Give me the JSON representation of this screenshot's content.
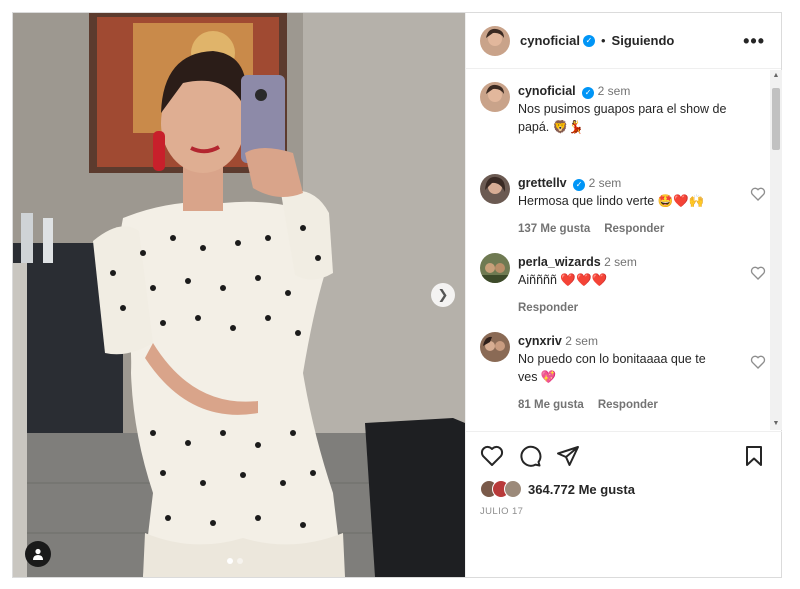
{
  "post": {
    "username": "cynoficial",
    "verified_mark": "✓",
    "separator": "•",
    "follow_status": "Siguiendo",
    "more_options": "•••",
    "caption": {
      "username": "cynoficial",
      "time": "2 sem",
      "text": "Nos pusimos guapos para el show de papá. 🦁💃"
    },
    "media": {
      "slides": 2,
      "active_slide": 1,
      "next_icon": "chevron-right-icon",
      "tag_icon": "user-tag-icon"
    }
  },
  "comments": [
    {
      "username": "grettellv",
      "verified": true,
      "time": "2 sem",
      "text": "Hermosa que lindo verte 🤩❤️🙌",
      "likes": "137 Me gusta",
      "reply": "Responder"
    },
    {
      "username": "perla_wizards",
      "verified": false,
      "time": "2 sem",
      "text": "Aiññññ ❤️❤️❤️",
      "likes": "",
      "reply": "Responder"
    },
    {
      "username": "cynxriv",
      "verified": false,
      "time": "2 sem",
      "text": "No puedo con lo bonitaaaa que te ves 💖",
      "likes": "81 Me gusta",
      "reply": "Responder"
    }
  ],
  "actions": {
    "like_icon": "heart-icon",
    "comment_icon": "comment-icon",
    "share_icon": "send-icon",
    "save_icon": "bookmark-icon",
    "like_count": "364.772 Me gusta",
    "date": "JULIO 17"
  },
  "colors": {
    "verified": "#0095f6",
    "text": "#262626",
    "muted": "#737373",
    "border": "#dbdbdb"
  }
}
